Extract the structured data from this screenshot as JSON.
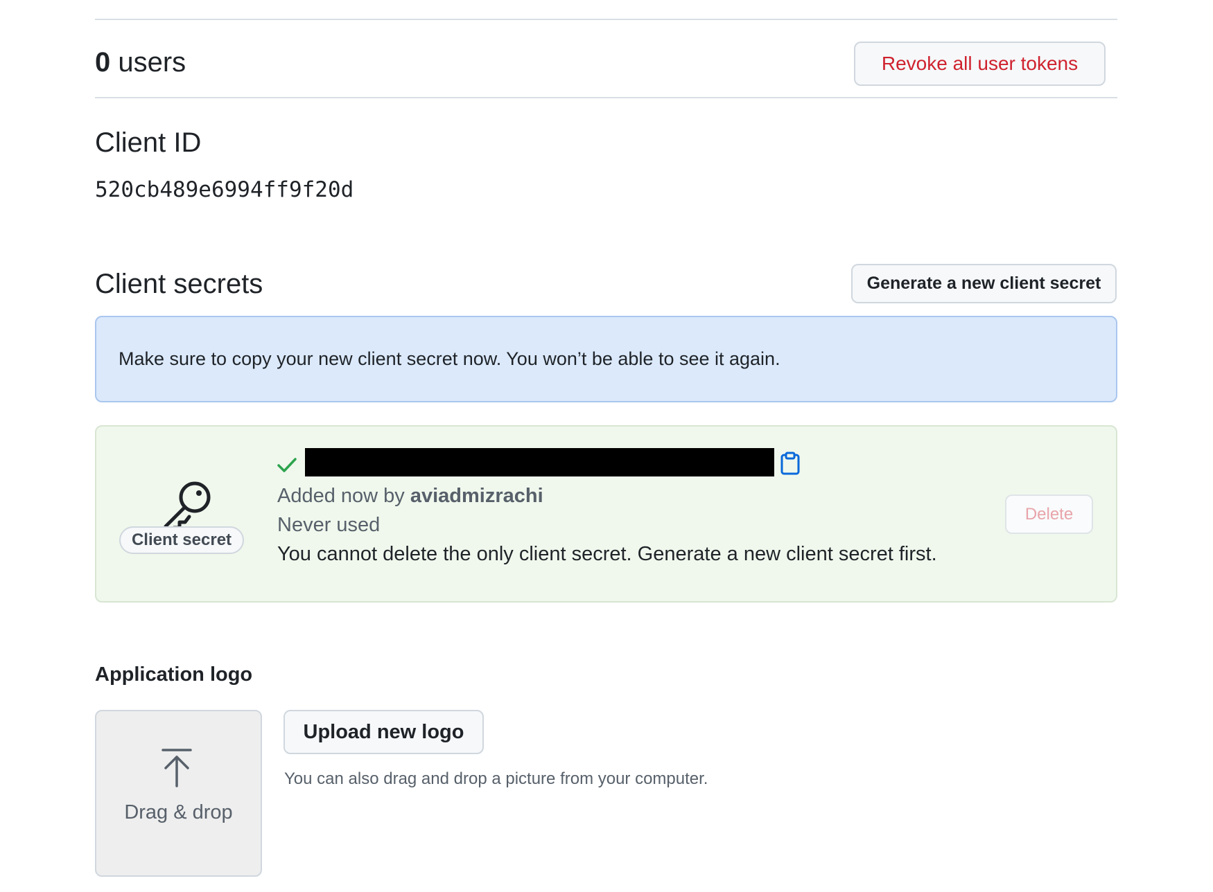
{
  "users": {
    "count": "0",
    "label": " users",
    "revoke_label": "Revoke all user tokens"
  },
  "client_id": {
    "heading": "Client ID",
    "value": "520cb489e6994ff9f20d"
  },
  "client_secrets": {
    "heading": "Client secrets",
    "generate_label": "Generate a new client secret",
    "flash_message": "Make sure to copy your new client secret now. You won’t be able to see it again.",
    "secret": {
      "badge": "Client secret",
      "added_prefix": "Added now by ",
      "added_by": "aviadmizrachi",
      "usage": "Never used",
      "note": "You cannot delete the only client secret. Generate a new client secret first.",
      "delete_label": "Delete",
      "icons": [
        "key-icon",
        "check-icon",
        "copy-icon"
      ]
    }
  },
  "application_logo": {
    "heading": "Application logo",
    "drop_label": "Drag & drop",
    "upload_label": "Upload new logo",
    "hint": "You can also drag and drop a picture from your computer.",
    "icons": [
      "upload-icon"
    ]
  },
  "colors": {
    "danger": "#cf222e",
    "flash_bg": "#dbe9fb",
    "success_bg": "#f0f8ed",
    "success_icon": "#2da44e",
    "accent": "#0969da"
  }
}
